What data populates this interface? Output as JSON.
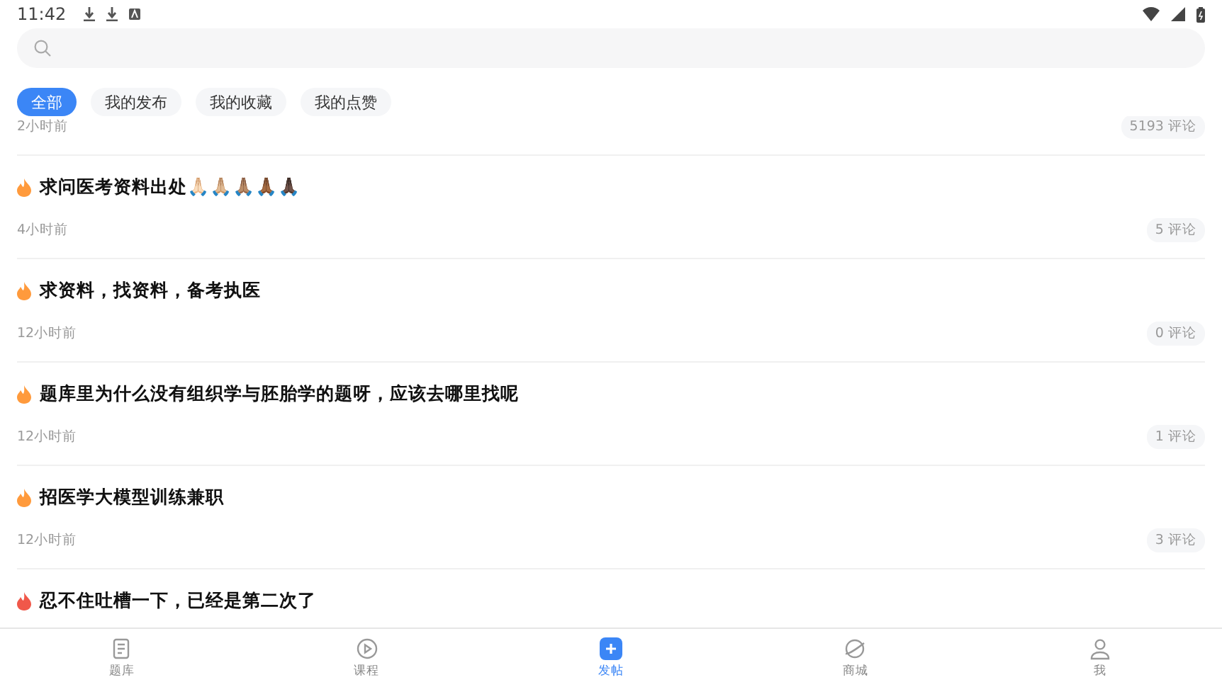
{
  "status_bar": {
    "time": "11:42"
  },
  "filters": [
    {
      "label": "全部",
      "selected": true
    },
    {
      "label": "我的发布",
      "selected": false
    },
    {
      "label": "我的收藏",
      "selected": false
    },
    {
      "label": "我的点赞",
      "selected": false
    }
  ],
  "posts": [
    {
      "time": "2小时前",
      "comments": "5193 评论"
    },
    {
      "title": "求问医考资料出处🙏🏻🙏🏼🙏🏽🙏🏾🙏🏿",
      "color": "#ff9a3c",
      "time": "4小时前",
      "comments": "5 评论"
    },
    {
      "title": "求资料，找资料，备考执医",
      "color": "#ff9a3c",
      "time": "12小时前",
      "comments": "0 评论"
    },
    {
      "title": "题库里为什么没有组织学与胚胎学的题呀，应该去哪里找呢",
      "color": "#ff9a3c",
      "time": "12小时前",
      "comments": "1 评论"
    },
    {
      "title": "招医学大模型训练兼职",
      "color": "#ff9a3c",
      "time": "12小时前",
      "comments": "3 评论"
    },
    {
      "title": "忍不住吐槽一下，已经是第二次了",
      "color": "#f0584a"
    }
  ],
  "tab_bar": [
    {
      "label": "题库",
      "kind": "doc",
      "selected": false
    },
    {
      "label": "课程",
      "kind": "play",
      "selected": false
    },
    {
      "label": "发帖",
      "kind": "post",
      "selected": true
    },
    {
      "label": "商城",
      "kind": "planet",
      "selected": false
    },
    {
      "label": "我",
      "kind": "user",
      "selected": false
    }
  ]
}
